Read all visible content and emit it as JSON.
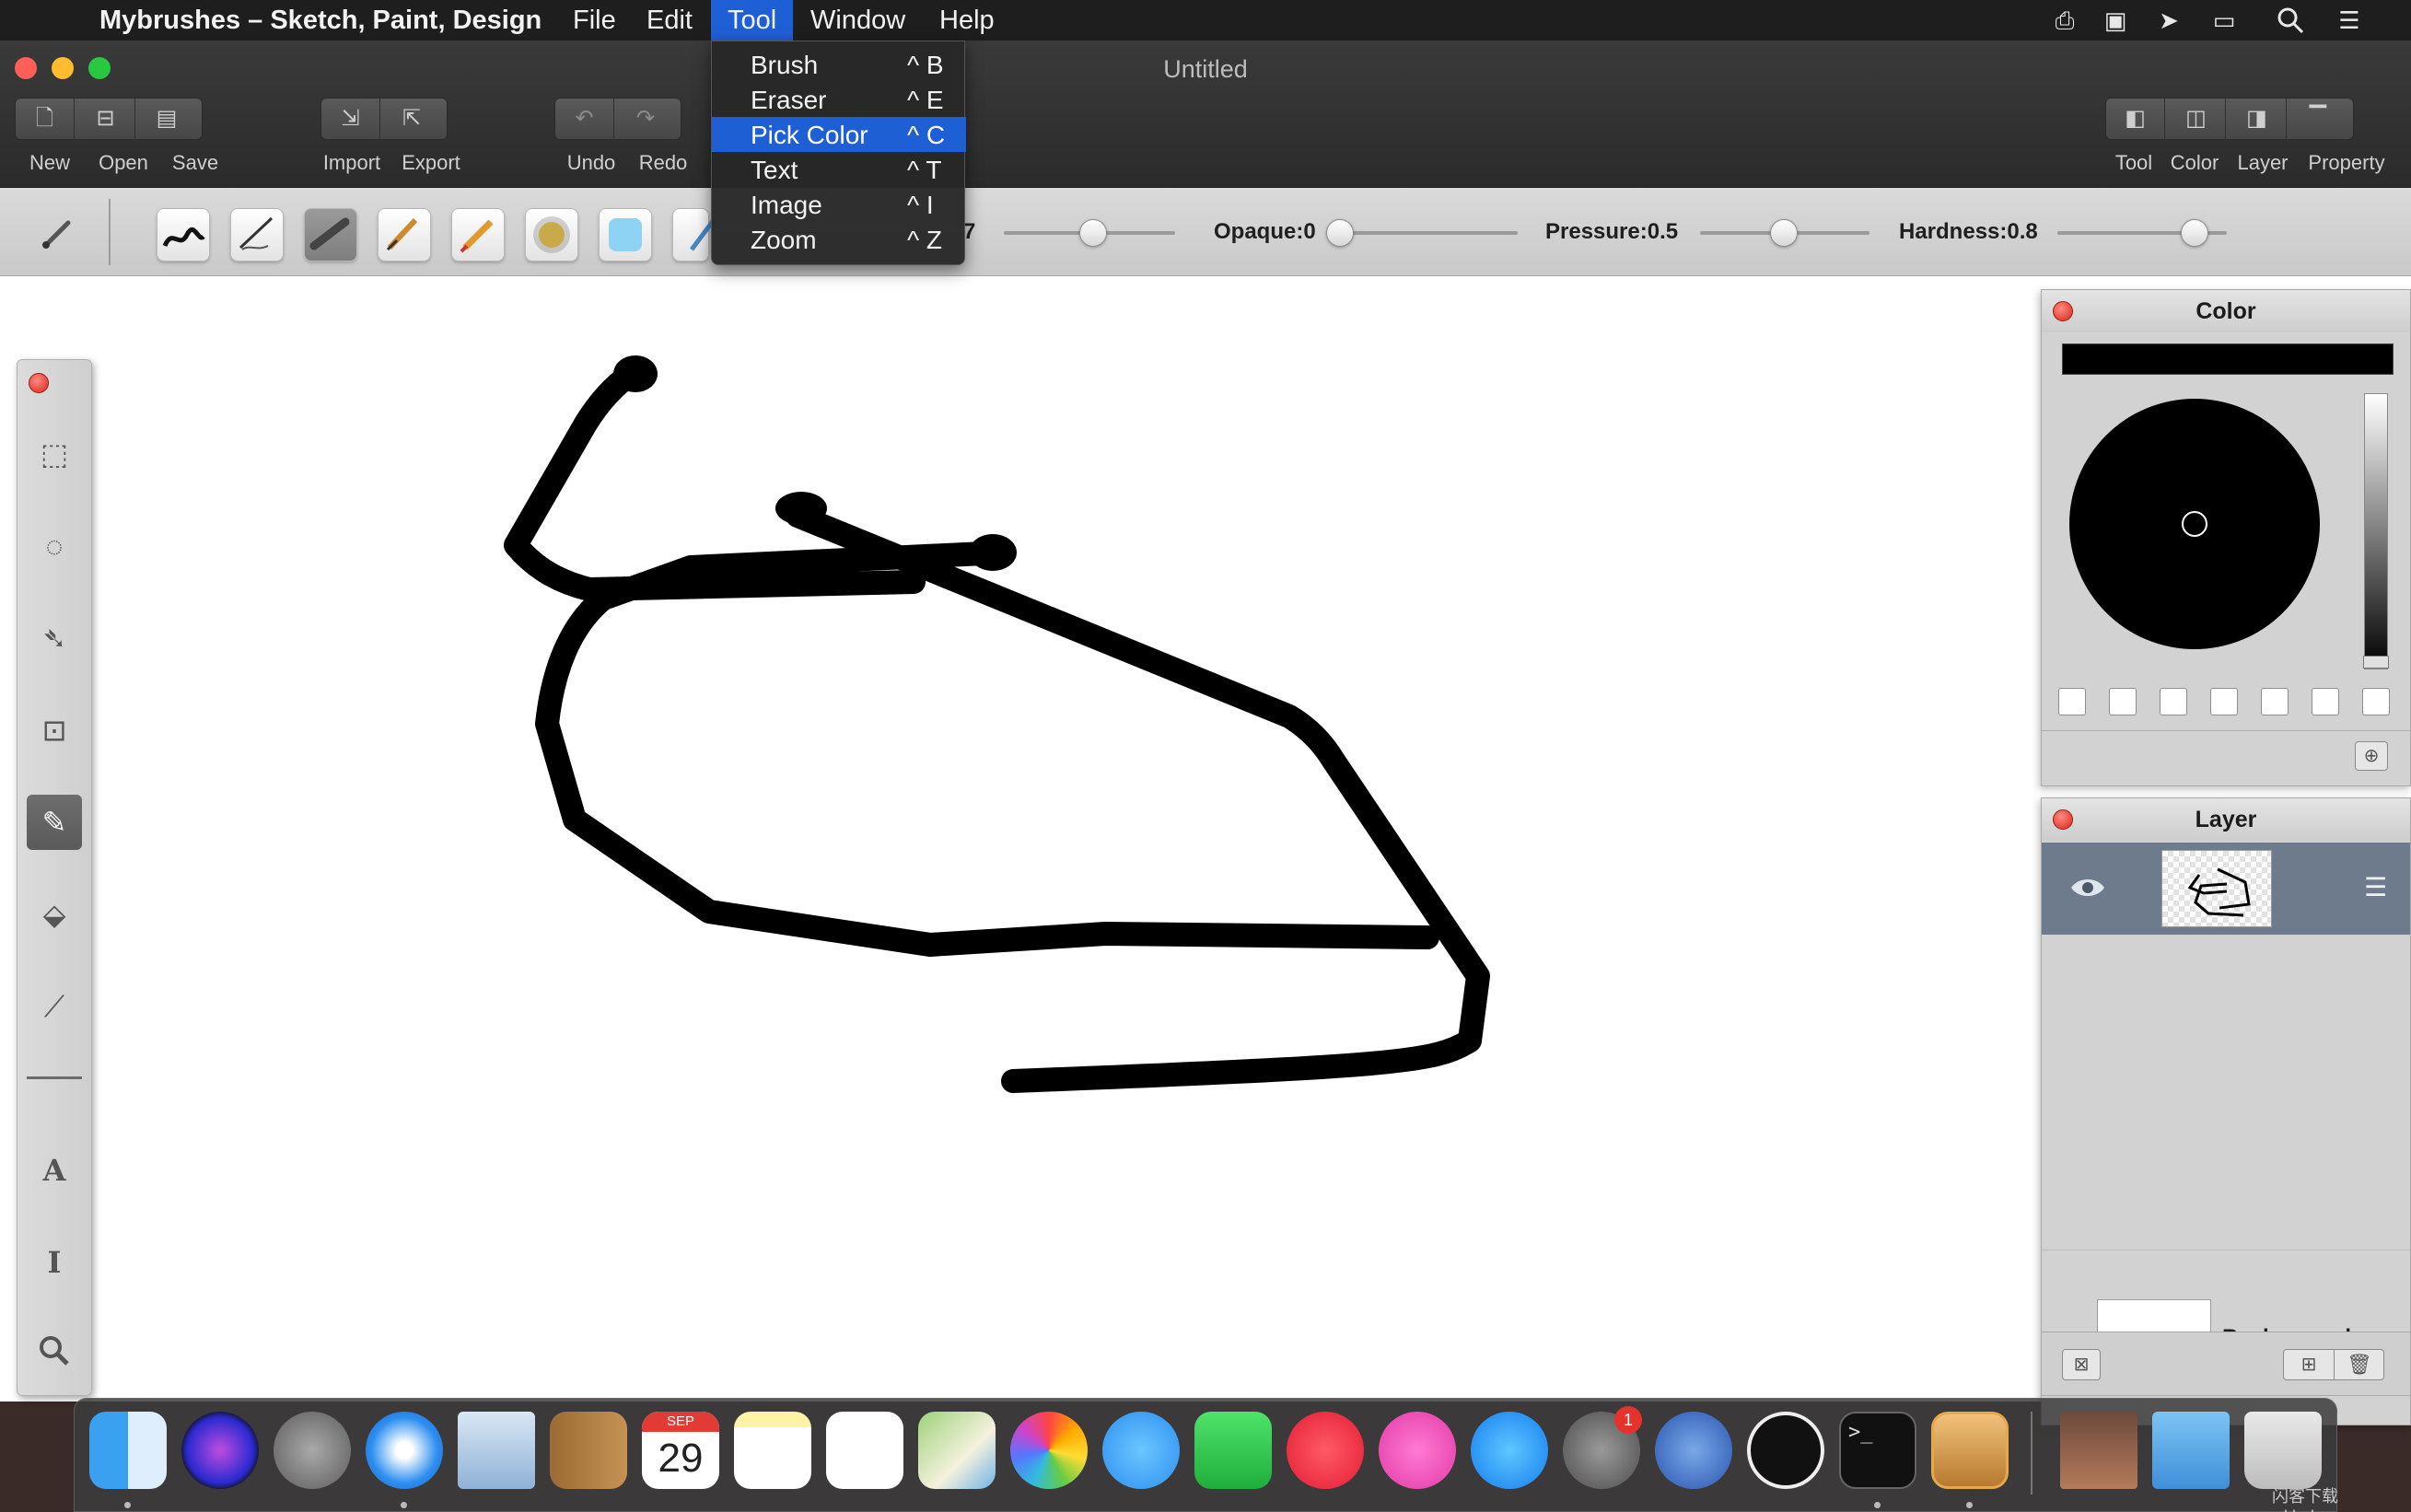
{
  "menubar": {
    "app_name": "Mybrushes – Sketch, Paint, Design",
    "menus": [
      "File",
      "Edit",
      "Tool",
      "Window",
      "Help"
    ],
    "active_menu": "Tool"
  },
  "tool_menu": {
    "items": [
      {
        "label": "Brush",
        "shortcut": "^ B"
      },
      {
        "label": "Eraser",
        "shortcut": "^ E"
      },
      {
        "label": "Pick Color",
        "shortcut": "^ C",
        "highlighted": true
      },
      {
        "label": "Text",
        "shortcut": "^ T"
      },
      {
        "label": "Image",
        "shortcut": "^ I"
      },
      {
        "label": "Zoom",
        "shortcut": "^ Z"
      }
    ]
  },
  "window": {
    "title": "Untitled",
    "toolbar": {
      "new": "New",
      "open": "Open",
      "save": "Save",
      "import": "Import",
      "export": "Export",
      "undo": "Undo",
      "redo": "Redo",
      "tool": "Tool",
      "color": "Color",
      "layer": "Layer",
      "property": "Property"
    }
  },
  "brush_bar": {
    "size_value_fragment": "7",
    "opaque_label": "Opaque:0",
    "pressure_label": "Pressure:0.5",
    "hardness_label": "Hardness:0.8",
    "slider_levels": {
      "size": 0.55,
      "opaque": 0.15,
      "pressure": 0.5,
      "hardness": 0.8
    }
  },
  "color_panel": {
    "title": "Color",
    "current_color": "#000000",
    "swatch_count": 7
  },
  "layer_panel": {
    "title": "Layer",
    "background_label": "Background"
  },
  "dock": {
    "calendar_month": "SEP",
    "calendar_day": "29",
    "badge_count": "1",
    "watermark": "闪客下载 wkhub.com"
  },
  "colors": {
    "menu_highlight": "#1f5fd6",
    "close": "#ff5f57",
    "minimize": "#febc2e",
    "zoom": "#28c840"
  }
}
